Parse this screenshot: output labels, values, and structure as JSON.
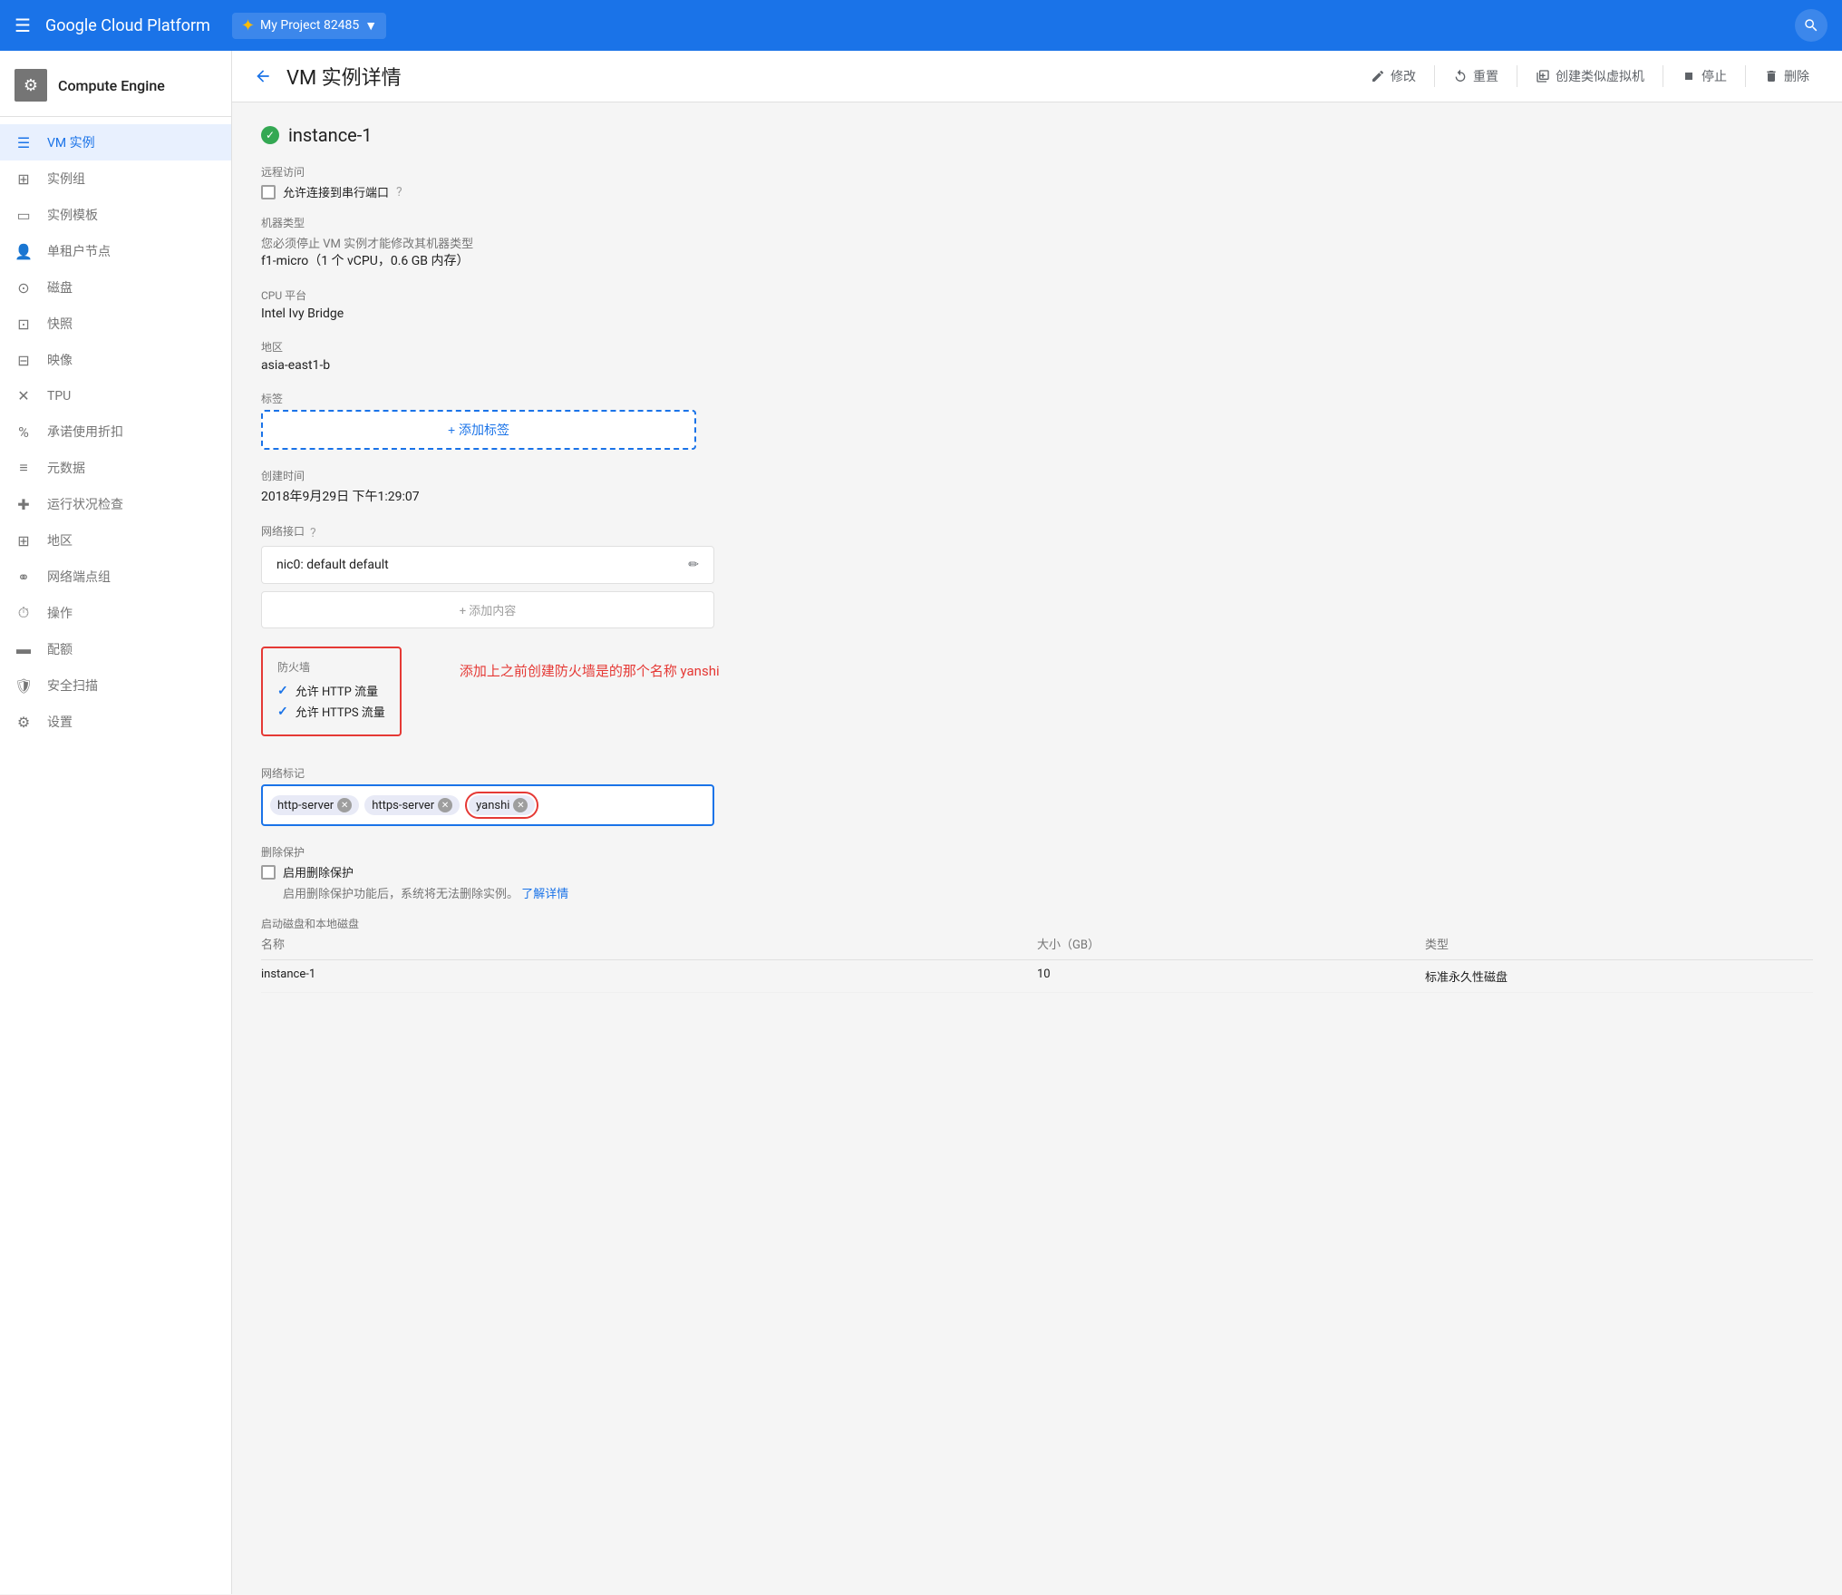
{
  "header": {
    "menu_icon": "☰",
    "brand": "Google Cloud Platform",
    "project": "My Project 82485",
    "project_arrow": "▼",
    "search_icon": "🔍"
  },
  "sidebar": {
    "brand_icon": "⚙",
    "brand_label": "Compute Engine",
    "items": [
      {
        "id": "vm-instances",
        "label": "VM 实例",
        "icon": "☰",
        "active": true
      },
      {
        "id": "instance-groups",
        "label": "实例组",
        "icon": "⊞"
      },
      {
        "id": "instance-templates",
        "label": "实例模板",
        "icon": "▭"
      },
      {
        "id": "sole-tenant-nodes",
        "label": "单租户节点",
        "icon": "👤"
      },
      {
        "id": "disks",
        "label": "磁盘",
        "icon": "⊙"
      },
      {
        "id": "snapshots",
        "label": "快照",
        "icon": "⊡"
      },
      {
        "id": "images",
        "label": "映像",
        "icon": "⊟"
      },
      {
        "id": "tpu",
        "label": "TPU",
        "icon": "✕"
      },
      {
        "id": "committed-use",
        "label": "承诺使用折扣",
        "icon": "%"
      },
      {
        "id": "metadata",
        "label": "元数据",
        "icon": "≡"
      },
      {
        "id": "health-checks",
        "label": "运行状况检查",
        "icon": "🛡"
      },
      {
        "id": "zones",
        "label": "地区",
        "icon": "⊞"
      },
      {
        "id": "network-endpoint-groups",
        "label": "网络端点组",
        "icon": "⚭"
      },
      {
        "id": "operations",
        "label": "操作",
        "icon": "⏱"
      },
      {
        "id": "quotas",
        "label": "配额",
        "icon": "▬"
      },
      {
        "id": "security-scans",
        "label": "安全扫描",
        "icon": "🛡"
      },
      {
        "id": "settings",
        "label": "设置",
        "icon": "⚙"
      }
    ]
  },
  "page": {
    "back_icon": "←",
    "title": "VM 实例详情",
    "actions": {
      "edit": "修改",
      "reset": "重置",
      "create_similar": "创建类似虚拟机",
      "stop": "停止",
      "delete": "删除"
    }
  },
  "instance": {
    "name": "instance-1",
    "status": "running",
    "remote_access": {
      "label": "远程访问",
      "serial_port": "允许连接到串行端口"
    },
    "machine_type": {
      "label": "机器类型",
      "note": "您必须停止 VM 实例才能修改其机器类型",
      "value": "f1-micro（1 个 vCPU，0.6 GB 内存）"
    },
    "cpu_platform": {
      "label": "CPU 平台",
      "value": "Intel Ivy Bridge"
    },
    "zone": {
      "label": "地区",
      "value": "asia-east1-b"
    },
    "tags": {
      "label": "标签",
      "add_button": "+ 添加标签"
    },
    "created_at": {
      "label": "创建时间",
      "value": "2018年9月29日 下午1:29:07"
    },
    "network_interface": {
      "label": "网络接口",
      "value": "nic0: default default"
    },
    "firewall": {
      "label": "防火墙",
      "http": "允许 HTTP 流量",
      "https": "允许 HTTPS 流量",
      "note": "添加上之前创建防火墙是的那个名称 yanshi"
    },
    "network_tags": {
      "label": "网络标记",
      "tags": [
        "http-server",
        "https-server",
        "yanshi"
      ]
    },
    "delete_protection": {
      "label": "删除保护",
      "checkbox_label": "启用删除保护",
      "description": "启用删除保护功能后，系统将无法删除实例。",
      "learn_more": "了解详情"
    },
    "boot_disk": {
      "label": "启动磁盘和本地磁盘",
      "columns": [
        "名称",
        "大小（GB）",
        "类型"
      ],
      "rows": [
        {
          "name": "instance-1",
          "size": "10",
          "type": "标准永久性磁盘"
        }
      ]
    }
  }
}
